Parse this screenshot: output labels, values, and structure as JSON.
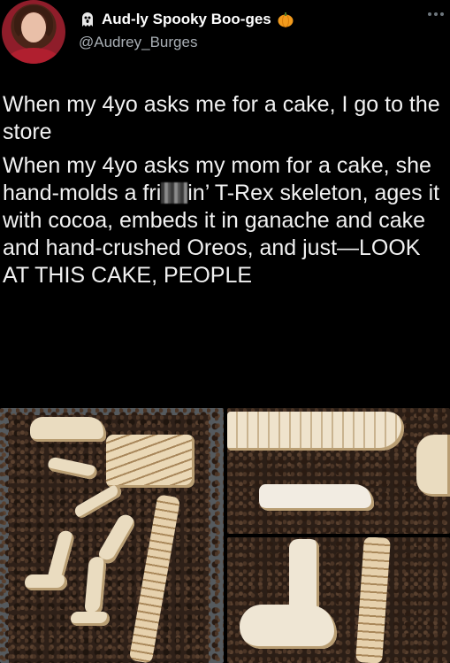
{
  "author": {
    "display_name": "Aud-ly Spooky Boo-ges",
    "handle": "@Audrey_Burges",
    "name_prefix_icon": "ghost-icon",
    "name_suffix_icon": "pumpkin-icon"
  },
  "tweet": {
    "paragraph_1": "When my 4yo asks me for a cake, I go to the store",
    "paragraph_2_before": "When my 4yo asks my mom for a cake, she hand-molds a fri",
    "paragraph_2_after": "in’ T-Rex skeleton, ages it with cocoa, embeds it in ganache and cake and hand-crushed Oreos, and just—LOOK AT THIS CAKE, PEOPLE"
  },
  "media": {
    "photo_count": 3
  },
  "colors": {
    "background": "#000000",
    "text": "#f1f1f1",
    "handle": "#a8aeb4",
    "pumpkin": "#f29b1d"
  }
}
